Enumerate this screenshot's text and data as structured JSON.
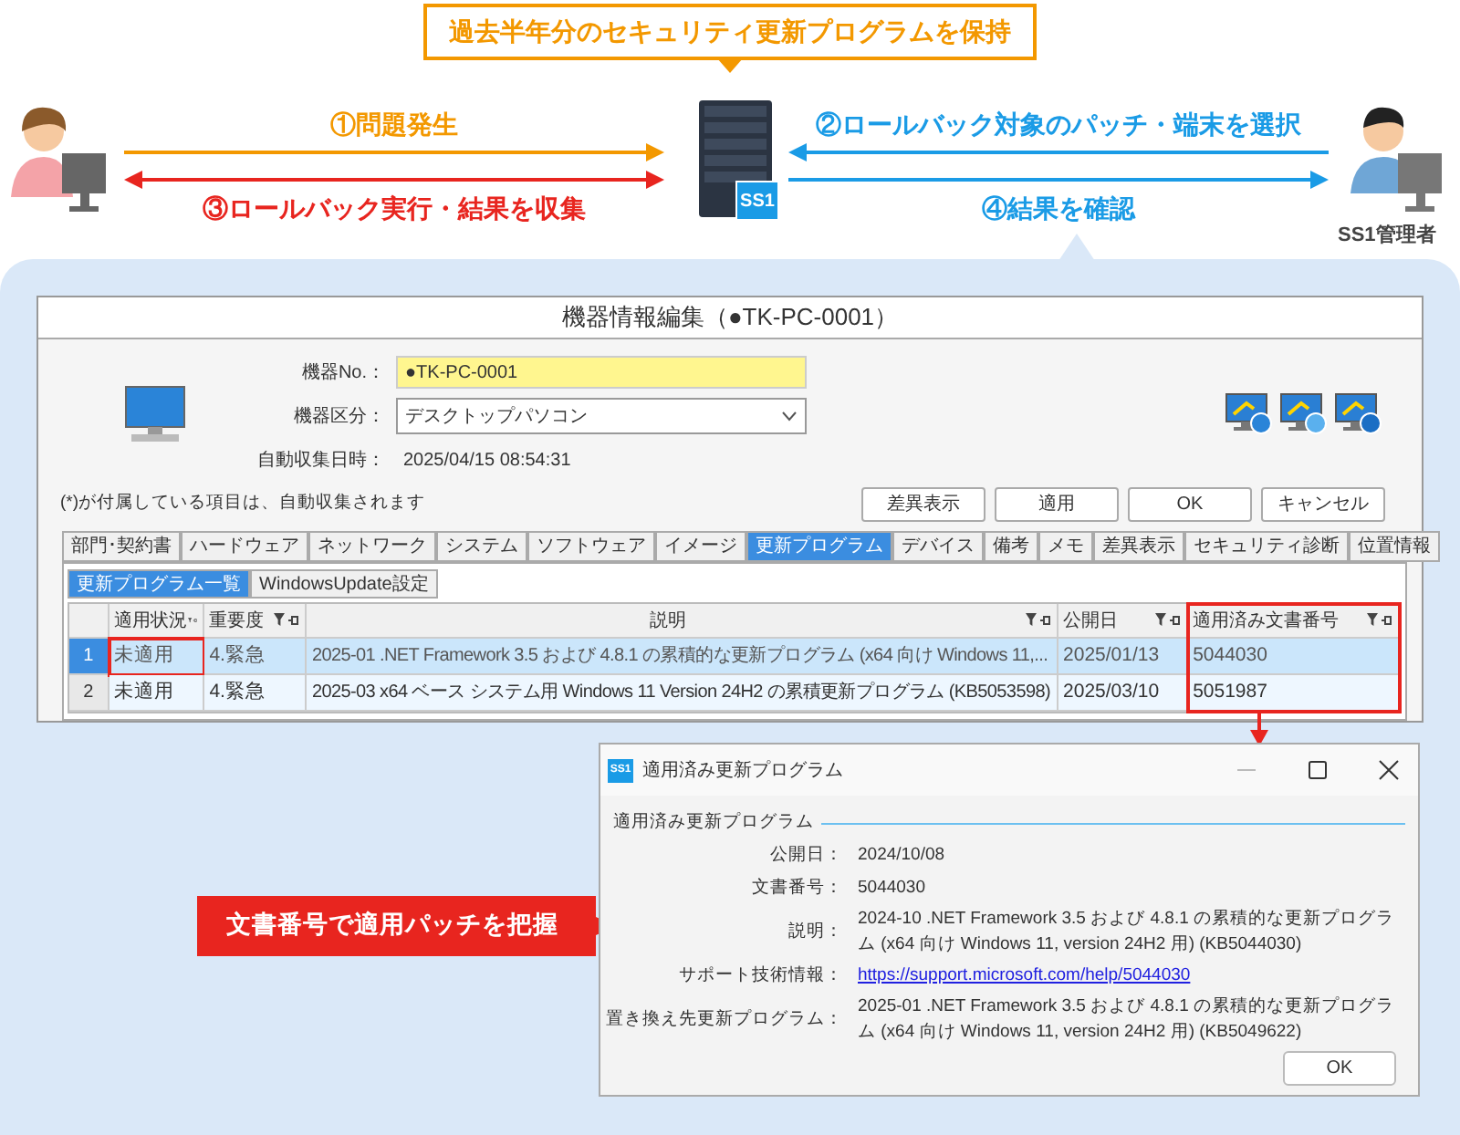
{
  "callout": "過去半年分のセキュリティ更新プログラムを保持",
  "flows": [
    {
      "label": "①問題発生",
      "color": "#f39800",
      "kind": "rightward"
    },
    {
      "label": "③ロールバック実行・結果を収集",
      "color": "#e8251f",
      "kind": "double"
    },
    {
      "label": "②ロールバック対象のパッチ・端末を選択",
      "color": "#1a9be6",
      "kind": "leftward"
    },
    {
      "label": "④結果を確認",
      "color": "#1a9be6",
      "kind": "rightward"
    }
  ],
  "server_badge": "SS1",
  "admin_label": "SS1管理者",
  "window": {
    "title": "機器情報編集（●TK-PC-0001）",
    "fields": [
      {
        "label": "機器No.：",
        "value": "●TK-PC-0001",
        "kind": "input",
        "highlighted": true
      },
      {
        "label": "機器区分：",
        "value": "デスクトップパソコン",
        "kind": "select",
        "highlighted": false
      },
      {
        "label": "自動収集日時：",
        "value": "2025/04/15 08:54:31",
        "kind": "text",
        "highlighted": false
      }
    ],
    "note": "(*)が付属している項目は、自動収集されます",
    "buttons": [
      "差異表示",
      "適用",
      "OK",
      "キャンセル"
    ],
    "tabs": [
      {
        "label": "部門･契約書",
        "selected": false
      },
      {
        "label": "ハードウェア",
        "selected": false
      },
      {
        "label": "ネットワーク",
        "selected": false
      },
      {
        "label": "システム",
        "selected": false
      },
      {
        "label": "ソフトウェア",
        "selected": false
      },
      {
        "label": "イメージ",
        "selected": false
      },
      {
        "label": "更新プログラム",
        "selected": true
      },
      {
        "label": "デバイス",
        "selected": false
      },
      {
        "label": "備考",
        "selected": false
      },
      {
        "label": "メモ",
        "selected": false
      },
      {
        "label": "差異表示",
        "selected": false
      },
      {
        "label": "セキュリティ診断",
        "selected": false
      },
      {
        "label": "位置情報",
        "selected": false
      }
    ],
    "subtabs": [
      {
        "label": "更新プログラム一覧",
        "selected": true
      },
      {
        "label": "WindowsUpdate設定",
        "selected": false
      }
    ],
    "table": {
      "columns": [
        {
          "label": "適用状況",
          "highlighted": false
        },
        {
          "label": "重要度",
          "highlighted": false
        },
        {
          "label": "説明",
          "highlighted": false
        },
        {
          "label": "公開日",
          "highlighted": false
        },
        {
          "label": "適用済み文書番号",
          "highlighted": true
        }
      ],
      "rows": [
        {
          "number": "1",
          "selected": true,
          "status_marked": true,
          "cells": [
            "未適用",
            "4.緊急",
            "2025-01 .NET Framework 3.5 および 4.8.1 の累積的な更新プログラム (x64 向け Windows 11,...",
            "2025/01/13",
            "5044030"
          ]
        },
        {
          "number": "2",
          "selected": false,
          "status_marked": false,
          "cells": [
            "未適用",
            "4.緊急",
            "2025-03 x64 ベース システム用 Windows 11 Version 24H2 の累積更新プログラム (KB5053598)",
            "2025/03/10",
            "5051987"
          ]
        }
      ]
    }
  },
  "banner": "文書番号で適用パッチを把握",
  "dialog": {
    "icon_text": "SS1",
    "title": "適用済み更新プログラム",
    "section": "適用済み更新プログラム",
    "fields": [
      {
        "label": "公開日：",
        "value": "2024/10/08",
        "kind": "text"
      },
      {
        "label": "文書番号：",
        "value": "5044030",
        "kind": "text"
      },
      {
        "label": "説明：",
        "value": "2024-10 .NET Framework 3.5 および 4.8.1 の累積的な更新プログラム (x64 向け Windows 11, version 24H2 用) (KB5044030)",
        "kind": "text"
      },
      {
        "label": "サポート技術情報：",
        "value": "https://support.microsoft.com/help/5044030",
        "kind": "link"
      },
      {
        "label": "置き換え先更新プログラム：",
        "value": "2025-01 .NET Framework 3.5 および 4.8.1 の累積的な更新プログラム (x64 向け Windows 11, version 24H2 用) (KB5049622)",
        "kind": "text"
      }
    ],
    "button": "OK"
  }
}
